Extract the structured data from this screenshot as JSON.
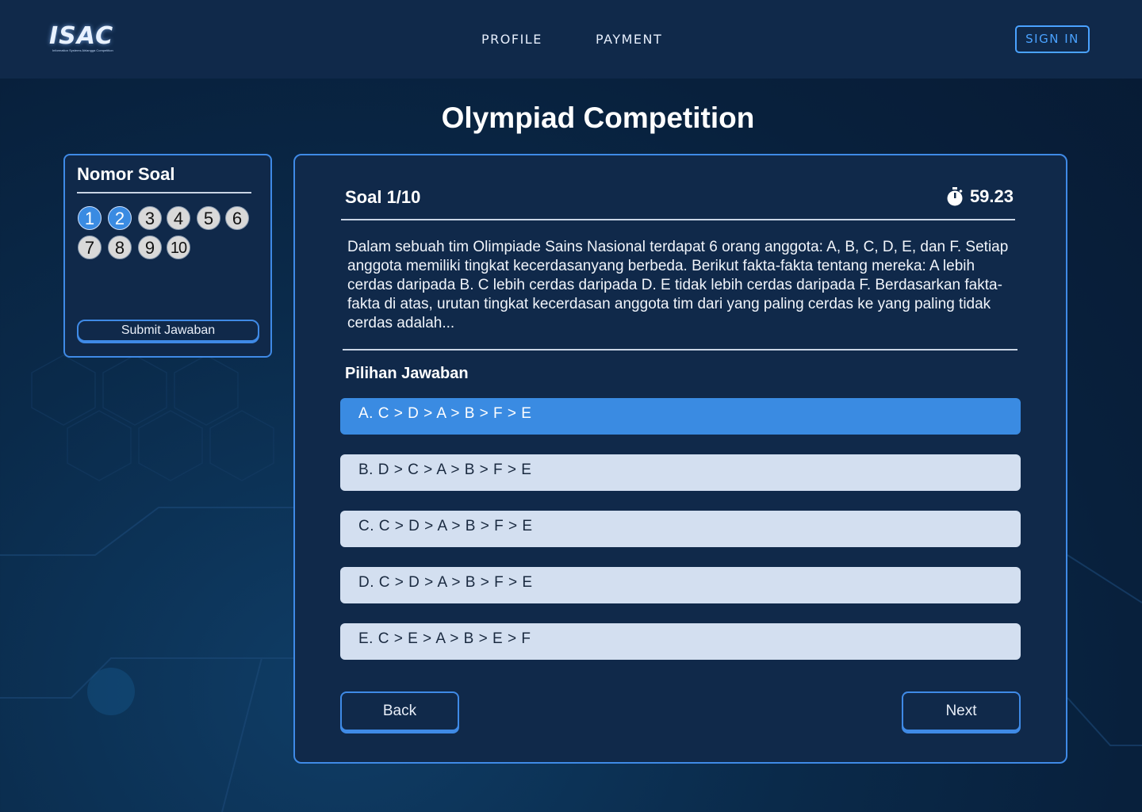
{
  "header": {
    "logo_text": "ISAC",
    "logo_subtitle": "Information Systems Airlangga Competition",
    "nav": [
      {
        "label": "PROFILE"
      },
      {
        "label": "PAYMENT"
      }
    ],
    "sign_in_label": "SIGN IN"
  },
  "page_title": "Olympiad Competition",
  "nomor_soal": {
    "title": "Nomor Soal",
    "numbers": [
      "1",
      "2",
      "3",
      "4",
      "5",
      "6",
      "7",
      "8",
      "9",
      "10"
    ],
    "active_numbers": [
      "1",
      "2"
    ],
    "submit_label": "Submit Jawaban"
  },
  "question_panel": {
    "soal_label": "Soal 1/10",
    "timer_icon": "stopwatch-icon",
    "timer_value": "59.23",
    "question_text": "Dalam sebuah tim Olimpiade Sains Nasional terdapat 6 orang anggota: A, B, C, D, E, dan F. Setiap anggota memiliki tingkat kecerdasanyang berbeda. Berikut fakta-fakta tentang mereka: A lebih cerdas daripada B. C lebih cerdas daripada D. E tidak lebih cerdas daripada F. Berdasarkan fakta-fakta di atas, urutan tingkat kecerdasan anggota tim dari yang paling cerdas ke yang paling tidak cerdas adalah...",
    "pilihan_title": "Pilihan Jawaban",
    "options": [
      {
        "label": "A. C > D > A > B > F > E",
        "selected": true
      },
      {
        "label": "B. D > C > A > B > F > E",
        "selected": false
      },
      {
        "label": "C. C > D > A > B > F > E",
        "selected": false
      },
      {
        "label": "D. C > D > A > B > F > E",
        "selected": false
      },
      {
        "label": "E. C > E > A > B > E > F",
        "selected": false
      }
    ],
    "back_label": "Back",
    "next_label": "Next"
  },
  "colors": {
    "accent": "#3a8be2",
    "panel_bg": "#10294a",
    "border": "#3f8ae6",
    "option_bg": "#d3dff0"
  }
}
